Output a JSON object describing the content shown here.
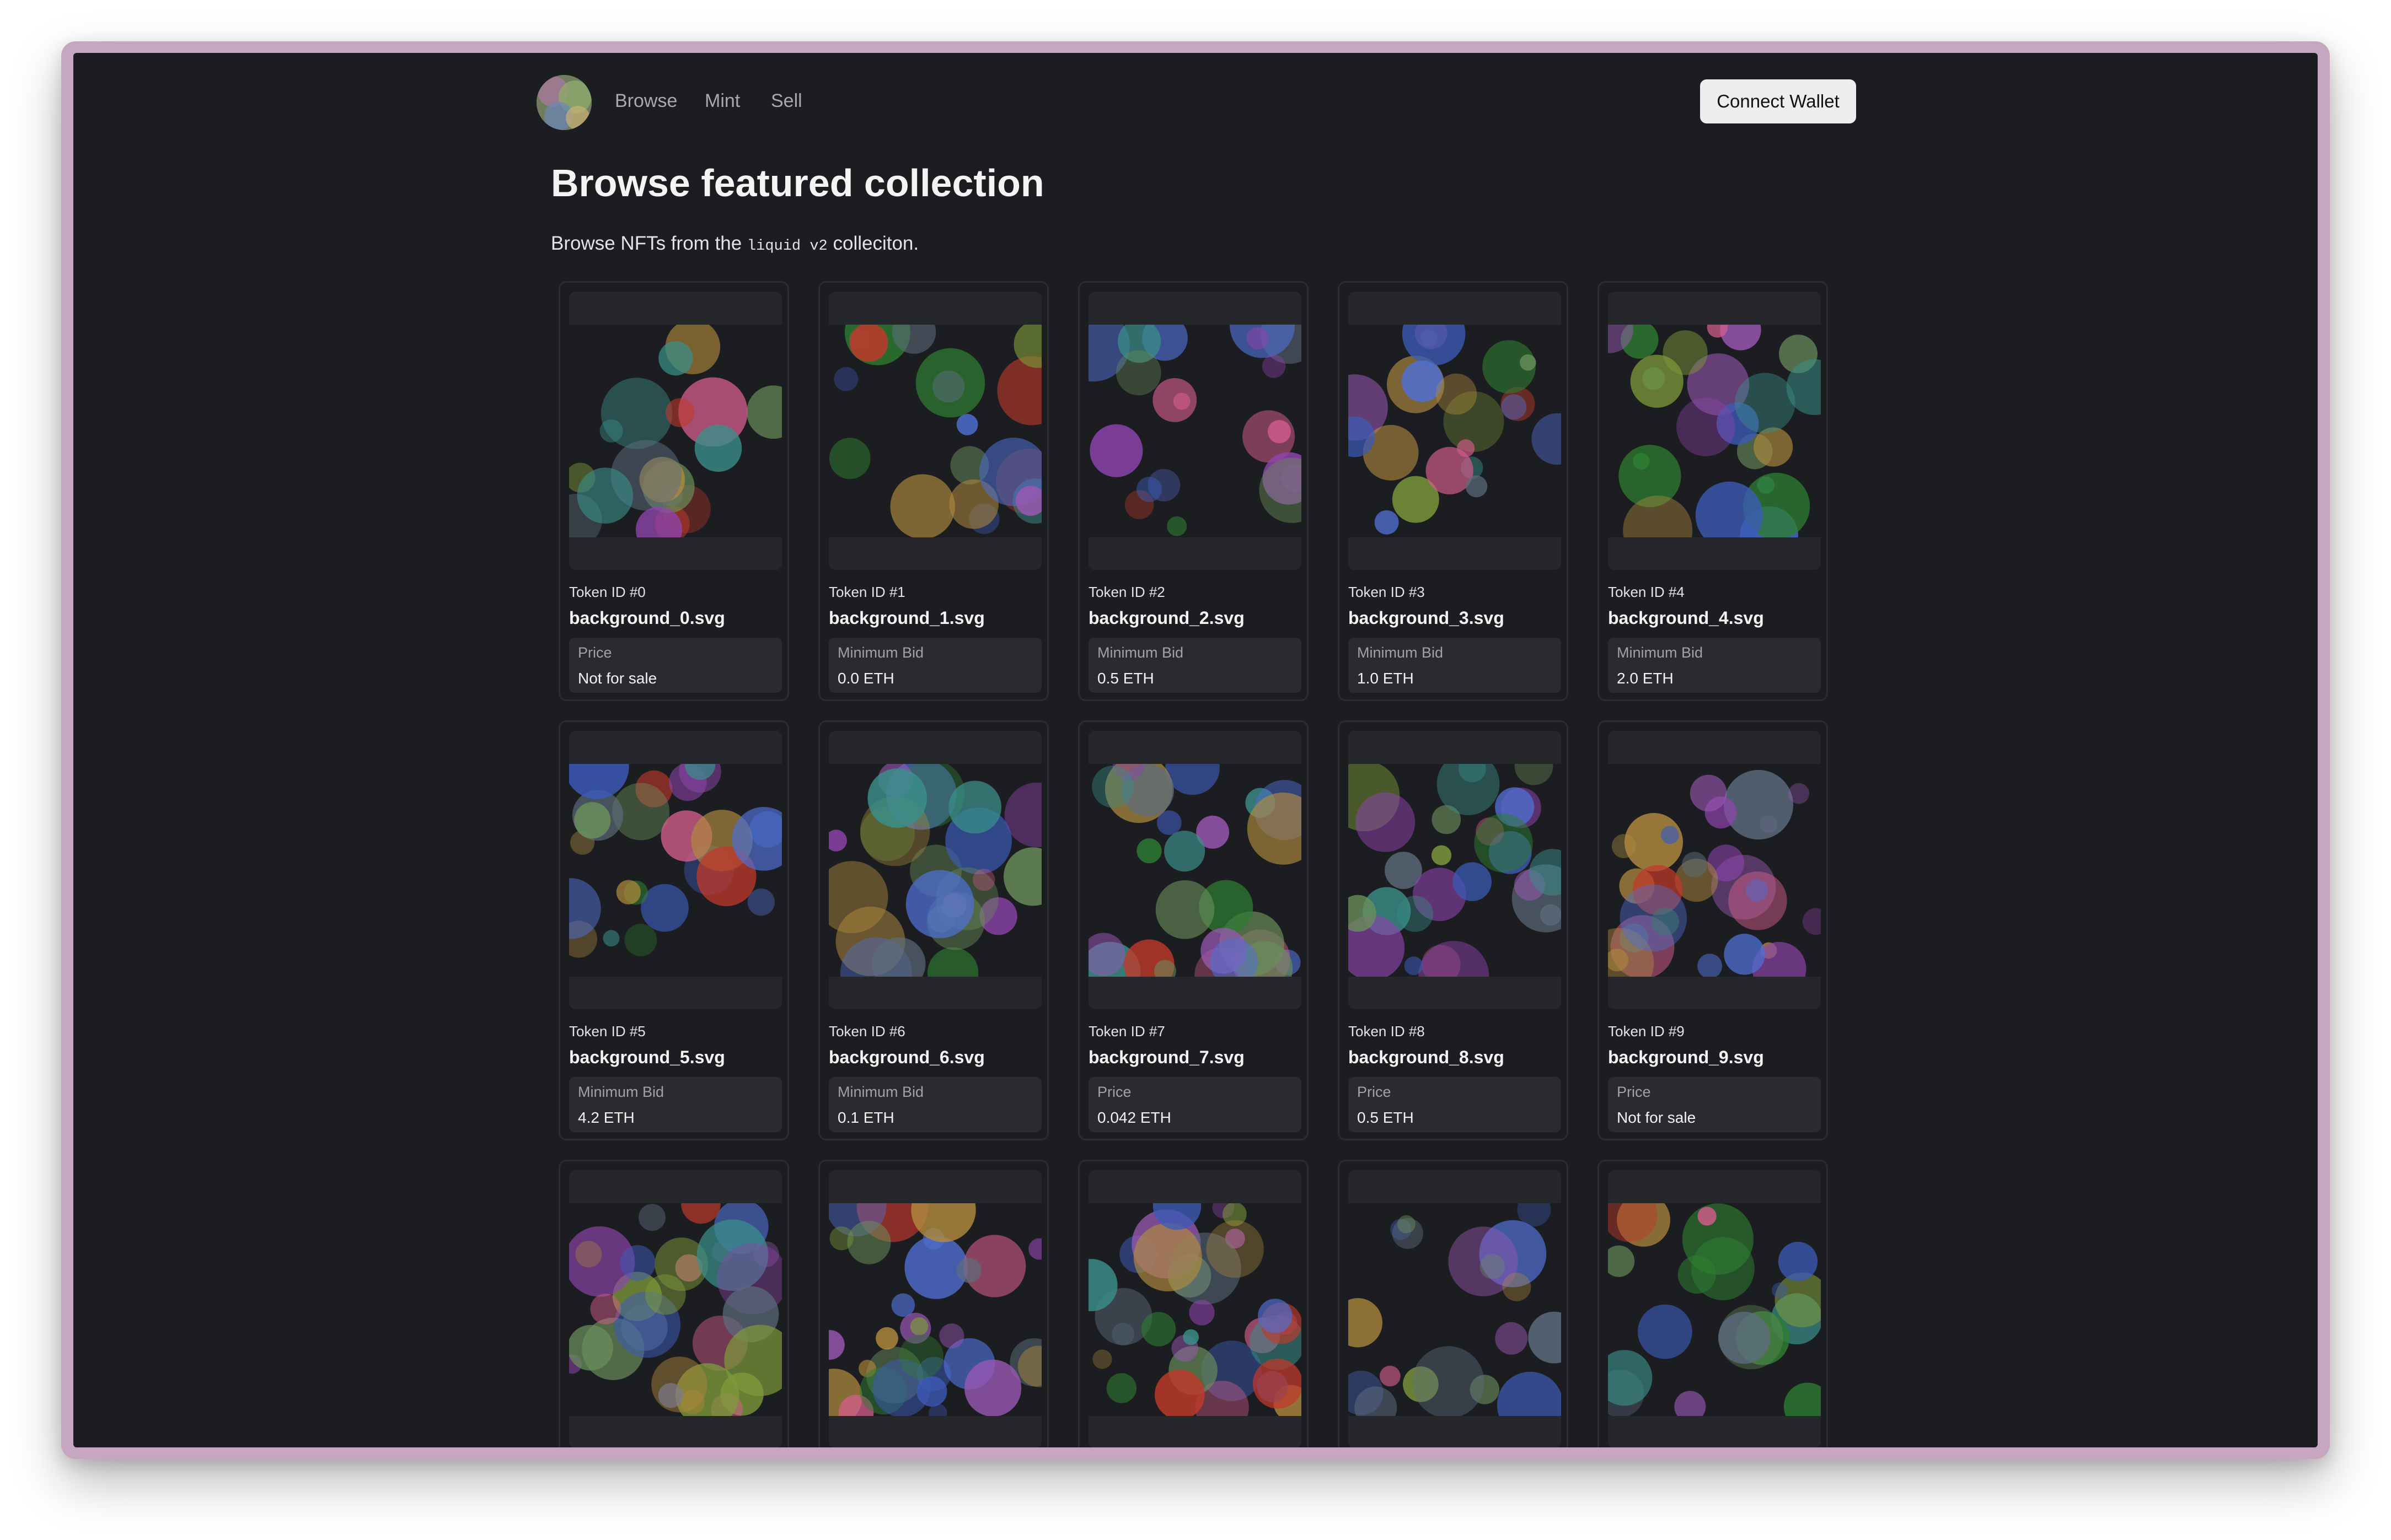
{
  "nav": {
    "logo": "collection-logo",
    "links": [
      "Browse",
      "Mint",
      "Sell"
    ],
    "connect_label": "Connect Wallet"
  },
  "page": {
    "title": "Browse featured collection",
    "subtitle_prefix": "Browse NFTs from the ",
    "subtitle_code": "liquid v2",
    "subtitle_suffix": " colleciton."
  },
  "cards": [
    {
      "token": "Token ID #0",
      "name": "background_0.svg",
      "label": "Price",
      "value": "Not for sale"
    },
    {
      "token": "Token ID #1",
      "name": "background_1.svg",
      "label": "Minimum Bid",
      "value": "0.0 ETH"
    },
    {
      "token": "Token ID #2",
      "name": "background_2.svg",
      "label": "Minimum Bid",
      "value": "0.5 ETH"
    },
    {
      "token": "Token ID #3",
      "name": "background_3.svg",
      "label": "Minimum Bid",
      "value": "1.0 ETH"
    },
    {
      "token": "Token ID #4",
      "name": "background_4.svg",
      "label": "Minimum Bid",
      "value": "2.0 ETH"
    },
    {
      "token": "Token ID #5",
      "name": "background_5.svg",
      "label": "Minimum Bid",
      "value": "4.2 ETH"
    },
    {
      "token": "Token ID #6",
      "name": "background_6.svg",
      "label": "Minimum Bid",
      "value": "0.1 ETH"
    },
    {
      "token": "Token ID #7",
      "name": "background_7.svg",
      "label": "Price",
      "value": "0.042 ETH"
    },
    {
      "token": "Token ID #8",
      "name": "background_8.svg",
      "label": "Price",
      "value": "0.5 ETH"
    },
    {
      "token": "Token ID #9",
      "name": "background_9.svg",
      "label": "Price",
      "value": "Not for sale"
    },
    {
      "token": "",
      "name": "",
      "label": "",
      "value": ""
    },
    {
      "token": "",
      "name": "",
      "label": "",
      "value": ""
    },
    {
      "token": "",
      "name": "",
      "label": "",
      "value": ""
    },
    {
      "token": "",
      "name": "",
      "label": "",
      "value": ""
    },
    {
      "token": "",
      "name": "",
      "label": "",
      "value": ""
    }
  ],
  "colors": {
    "background": "#1c1d20",
    "card_border": "#2b2c30",
    "image_bg": "#26272b",
    "frame": "#c7a6c1",
    "bubble_palette": [
      "#8e44ad",
      "#2e7d32",
      "#4f6fd1",
      "#c0392b",
      "#7d9a3a",
      "#3a8f8a",
      "#b08a3e",
      "#9b59b6",
      "#5d6d7e",
      "#d35d8b",
      "#3c5bb8",
      "#6a8f5b"
    ]
  }
}
